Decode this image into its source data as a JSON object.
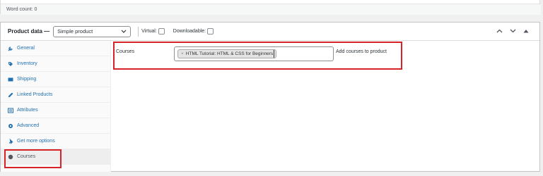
{
  "editor": {
    "word_count_label": "Word count: 0"
  },
  "product_data": {
    "title": "Product data —",
    "product_type": "Simple product",
    "virtual_label": "Virtual:",
    "downloadable_label": "Downloadable:",
    "tabs": [
      {
        "label": "General",
        "icon": "wrench-icon"
      },
      {
        "label": "Inventory",
        "icon": "tag-icon"
      },
      {
        "label": "Shipping",
        "icon": "truck-icon"
      },
      {
        "label": "Linked Products",
        "icon": "link-icon"
      },
      {
        "label": "Attributes",
        "icon": "list-icon"
      },
      {
        "label": "Advanced",
        "icon": "gear-icon"
      },
      {
        "label": "Get more options",
        "icon": "plug-icon"
      },
      {
        "label": "Courses",
        "icon": "circle-icon"
      }
    ],
    "courses_field": {
      "label": "Courses",
      "selected_course": "HTML Tutorial: HTML & CSS for Beginners",
      "remove_glyph": "×",
      "description": "Add courses to product"
    }
  },
  "colors": {
    "link": "#2271b1",
    "highlight": "#d6232a"
  }
}
